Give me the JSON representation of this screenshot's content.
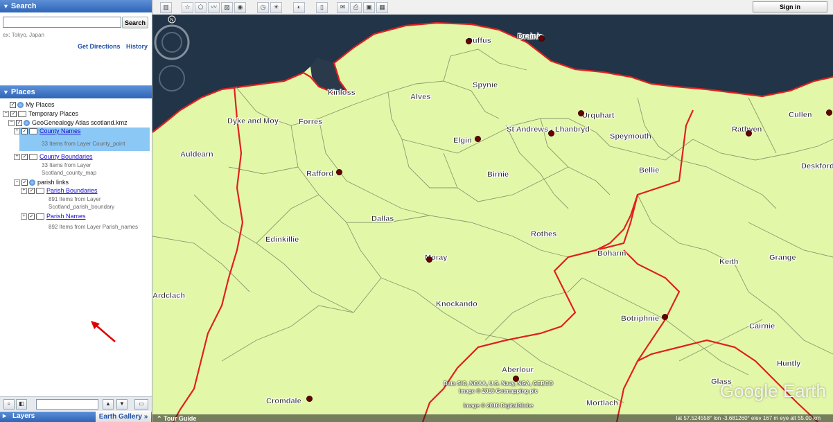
{
  "search": {
    "title": "Search",
    "placeholder": "",
    "button_label": "Search",
    "hint": "ex: Tokyo, Japan",
    "get_directions": "Get Directions",
    "history": "History"
  },
  "places": {
    "title": "Places",
    "my_places": "My Places",
    "temporary_places": "Temporary Places",
    "kmz_name": "GeoGenealogy Atlas scotland.kmz",
    "county_names": {
      "label": "County Names",
      "sub": "33 Items from Layer County_point"
    },
    "county_boundaries": {
      "label": "County Boundaries",
      "sub1": "33 Items from Layer",
      "sub2": "Scotland_county_map"
    },
    "parish_links": "parish links",
    "parish_boundaries": {
      "label": "Parish Boundaries",
      "sub1": "891 Items from Layer",
      "sub2": "Scotland_parish_boundary"
    },
    "parish_names": {
      "label": "Parish Names",
      "sub": "892 Items from Layer Parish_names"
    }
  },
  "bottom": {
    "layers": "Layers",
    "earth_gallery": "Earth Gallery »"
  },
  "toolbar": {
    "sign_in": "Sign in"
  },
  "map": {
    "labels": [
      "Duffus",
      "Drainie",
      "Kinloss",
      "Alves",
      "Spynie",
      "Dyke and Moy",
      "Forres",
      "Urquhart",
      "Cullen",
      "St Andrews - Lhanbryd",
      "Rathven",
      "Speymouth",
      "Elgin",
      "Auldearn",
      "Deskford",
      "Rafford",
      "Birnie",
      "Bellie",
      "Dallas",
      "Edinkillie",
      "Rothes",
      "Moray",
      "Boharm",
      "Keith",
      "Grange",
      "Ardclach",
      "Knockando",
      "Botriphnie",
      "Cairnie",
      "Aberlour",
      "Huntly",
      "Cromdale",
      "Glass",
      "Mortlach"
    ],
    "attribution": [
      "Data SIO, NOAA, U.S. Navy, NGA, GEBCO",
      "Image © 2016 Getmapping plc",
      "Image © 2016 DigitalGlobe"
    ],
    "logo": "Google Earth",
    "tour_guide": "Tour Guide",
    "status": "lat  57.524558°  lon  -3.681260°  elev  167 m     eye alt  55.00 km"
  },
  "colors": {
    "land": "#e3f7a8",
    "sea": "#1f3346",
    "county_border": "#e02020",
    "parish_border": "#8a9a70",
    "sidebar_header": "#3b73c4"
  }
}
